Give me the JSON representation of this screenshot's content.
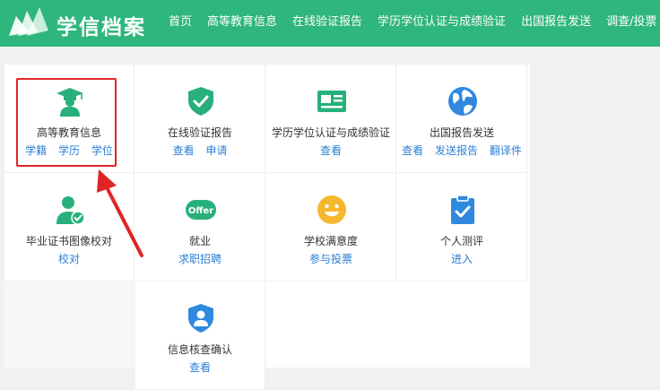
{
  "header": {
    "brand": "学信档案",
    "nav": [
      "首页",
      "高等教育信息",
      "在线验证报告",
      "学历学位认证与成绩验证",
      "出国报告发送",
      "调查/投票"
    ]
  },
  "tiles": [
    {
      "title": "高等教育信息",
      "links": [
        "学籍",
        "学历",
        "学位"
      ],
      "icon": "graduate-icon"
    },
    {
      "title": "在线验证报告",
      "links": [
        "查看",
        "申请"
      ],
      "icon": "shield-check-icon"
    },
    {
      "title": "学历学位认证与成绩验证",
      "links": [
        "查看"
      ],
      "icon": "id-card-icon"
    },
    {
      "title": "出国报告发送",
      "links": [
        "查看",
        "发送报告",
        "翻译件"
      ],
      "icon": "globe-icon"
    },
    {
      "title": "毕业证书图像校对",
      "links": [
        "校对"
      ],
      "icon": "user-check-icon"
    },
    {
      "title": "就业",
      "links": [
        "求职招聘"
      ],
      "icon": "offer-icon",
      "badge": "Offer"
    },
    {
      "title": "学校满意度",
      "links": [
        "参与投票"
      ],
      "icon": "smiley-icon"
    },
    {
      "title": "个人测评",
      "links": [
        "进入"
      ],
      "icon": "clipboard-check-icon"
    },
    {
      "title": "信息核查确认",
      "links": [
        "查看"
      ],
      "icon": "shield-user-icon"
    }
  ],
  "colors": {
    "header_bg": "#2fb67c",
    "link": "#2b7fd6",
    "icon_green": "#27b07b",
    "icon_blue": "#2f89de",
    "icon_yellow": "#f5b72e",
    "annotation_red": "#e02424"
  }
}
